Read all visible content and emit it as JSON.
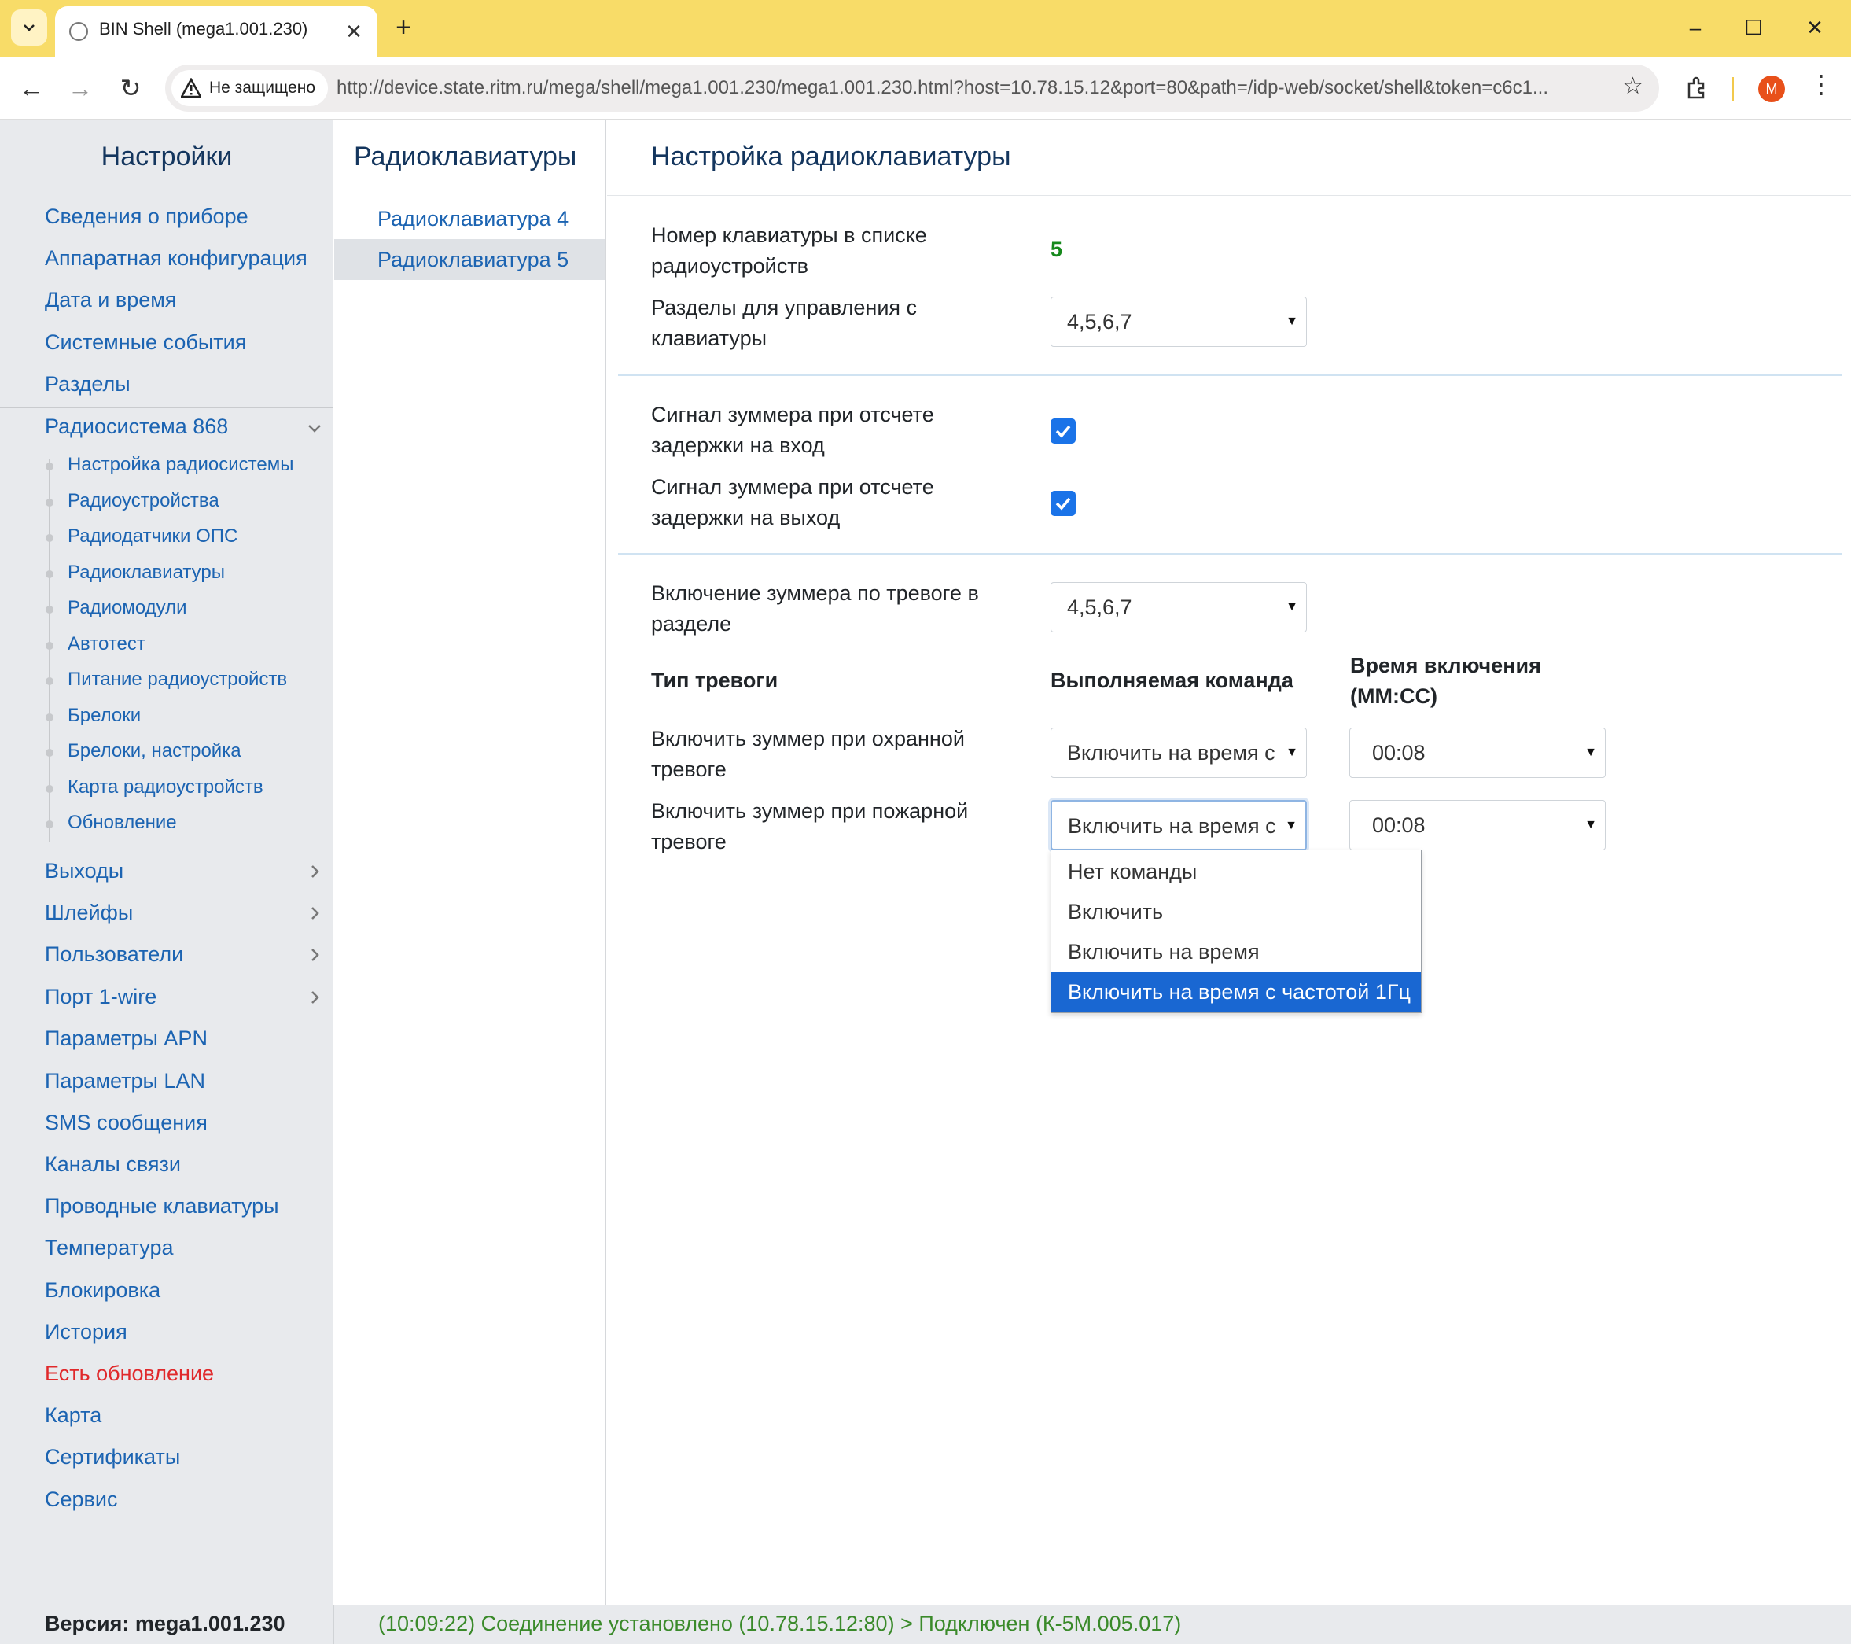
{
  "browser": {
    "tab_title": "BIN Shell (mega1.001.230)",
    "security_label": "Не защищено",
    "url": "http://device.state.ritm.ru/mega/shell/mega1.001.230/mega1.001.230.html?host=10.78.15.12&port=80&path=/idp-web/socket/shell&token=c6c1...",
    "avatar_letter": "M",
    "accent": "#f8dc68"
  },
  "sidebar": {
    "title": "Настройки",
    "items_top": [
      "Сведения о приборе",
      "Аппаратная конфигурация",
      "Дата и время",
      "Системные события",
      "Разделы"
    ],
    "group_label": "Радиосистема 868",
    "group_items": [
      "Настройка радиосистемы",
      "Радиоустройства",
      "Радиодатчики ОПС",
      "Радиоклавиатуры",
      "Радиомодули",
      "Автотест",
      "Питание радиоустройств",
      "Брелоки",
      "Брелоки, настройка",
      "Карта радиоустройств",
      "Обновление"
    ],
    "items_bottom": [
      "Выходы",
      "Шлейфы",
      "Пользователи",
      "Порт 1-wire",
      "Параметры APN",
      "Параметры LAN",
      "SMS сообщения",
      "Каналы связи",
      "Проводные клавиатуры",
      "Температура",
      "Блокировка",
      "История",
      "Есть обновление",
      "Карта",
      "Сертификаты",
      "Сервис"
    ]
  },
  "middle": {
    "title": "Радиоклавиатуры",
    "items": [
      "Радиоклавиатура 4",
      "Радиоклавиатура 5"
    ],
    "active_index": 1
  },
  "main": {
    "title": "Настройка радиоклавиатуры",
    "keypad_number_label": "Номер клавиатуры в списке радиоустройств",
    "keypad_number_value": "5",
    "partitions_label": "Разделы для управления с клавиатуры",
    "partitions_value": "4,5,6,7",
    "buzzer_entry_label": "Сигнал зуммера при отсчете задержки на вход",
    "buzzer_entry_checked": true,
    "buzzer_exit_label": "Сигнал зуммера при отсчете задержки на выход",
    "buzzer_exit_checked": true,
    "buzzer_alarm_label": "Включение зуммера по тревоге в разделе",
    "buzzer_alarm_value": "4,5,6,7",
    "col_alarm_type": "Тип тревоги",
    "col_command": "Выполняемая команда",
    "col_time": "Время включения (ММ:СС)",
    "rows": [
      {
        "label": "Включить зуммер при охранной тревоге",
        "command": "Включить на время с",
        "time": "00:08"
      },
      {
        "label": "Включить зуммер при пожарной тревоге",
        "command": "Включить на время с",
        "time": "00:08"
      }
    ],
    "dropdown_options": [
      "Нет команды",
      "Включить",
      "Включить на время",
      "Включить на время с частотой 1Гц"
    ],
    "dropdown_selected_index": 3
  },
  "footer": {
    "version": "Версия: mega1.001.230",
    "status": "(10:09:22) Соединение установлено (10.78.15.12:80) > Подключен (К-5М.005.017)"
  },
  "colors": {
    "link": "#1c64b2",
    "heading": "#14365e",
    "update": "#e0292b",
    "ok": "#3a8a2a",
    "checkbox": "#1a73e8"
  }
}
